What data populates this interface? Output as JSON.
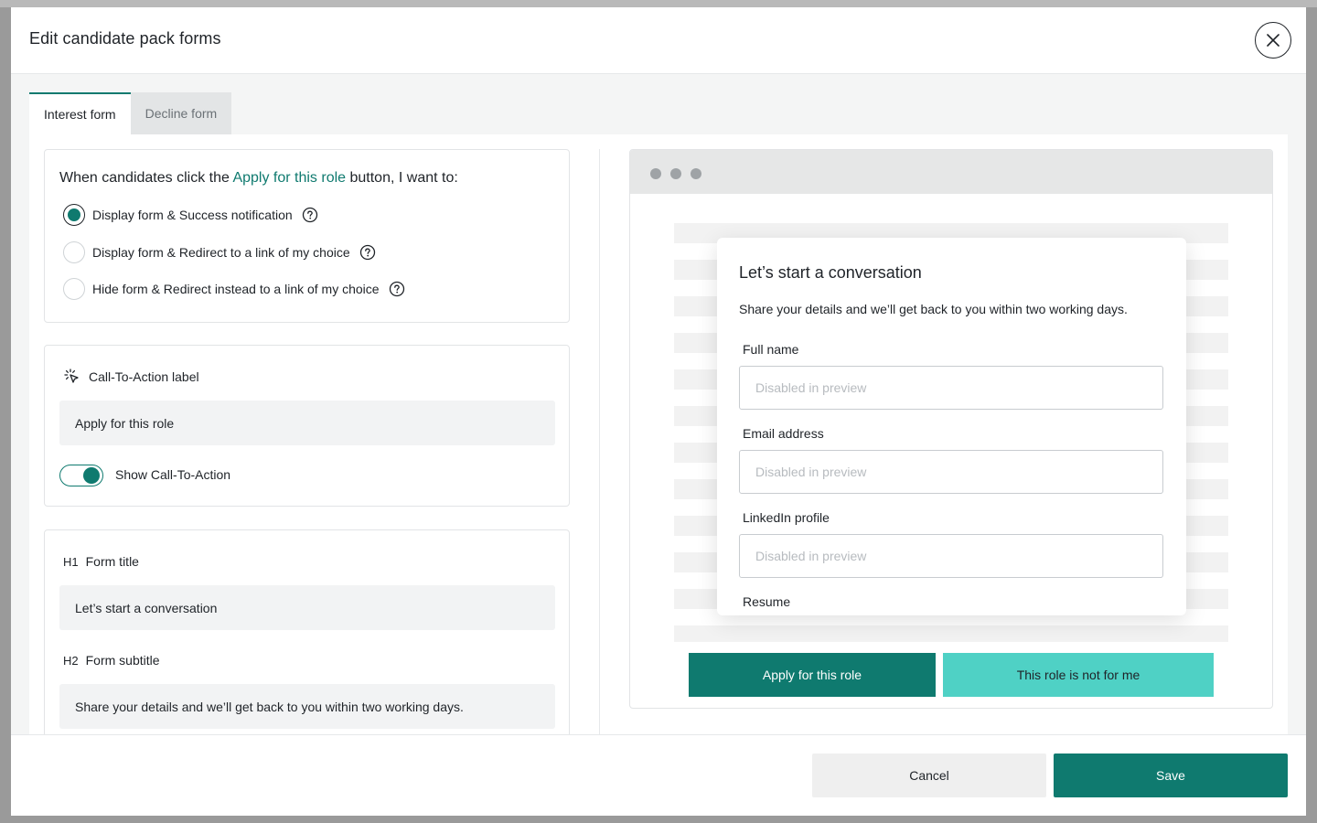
{
  "modal": {
    "title": "Edit candidate pack forms"
  },
  "tabs": [
    {
      "label": "Interest form",
      "active": true
    },
    {
      "label": "Decline form",
      "active": false
    }
  ],
  "behavior": {
    "question_prefix": "When candidates click the ",
    "question_link": "Apply for this role",
    "question_suffix": " button, I want to:",
    "options": [
      {
        "label": "Display form & Success notification",
        "checked": true
      },
      {
        "label": "Display form & Redirect to a link of my choice",
        "checked": false
      },
      {
        "label": "Hide form & Redirect instead to a link of my choice",
        "checked": false
      }
    ]
  },
  "cta": {
    "section_label": "Call-To-Action label",
    "input_value": "Apply for this role",
    "toggle_label": "Show Call-To-Action",
    "toggle_on": true
  },
  "titles": {
    "h1_tag": "H1",
    "h1_label": "Form title",
    "h1_value": "Let’s start a conversation",
    "h2_tag": "H2",
    "h2_label": "Form subtitle",
    "h2_value": "Share your details and we’ll get back to you within two working days."
  },
  "preview": {
    "form_title": "Let’s start a conversation",
    "form_subtitle": "Share your details and we’ll get back to you within two working days.",
    "fields": [
      {
        "label": "Full name",
        "placeholder": "Disabled in preview"
      },
      {
        "label": "Email address",
        "placeholder": "Disabled in preview"
      },
      {
        "label": "LinkedIn profile",
        "placeholder": "Disabled in preview"
      }
    ],
    "next_field_label": "Resume",
    "apply_button": "Apply for this role",
    "decline_button": "This role is not for me"
  },
  "footer": {
    "cancel_label": "Cancel",
    "save_label": "Save"
  },
  "colors": {
    "accent": "#0f7a6f",
    "accent_light": "#4fd1c5"
  },
  "icons": [
    "close-icon",
    "help-icon",
    "cursor-click-icon"
  ]
}
